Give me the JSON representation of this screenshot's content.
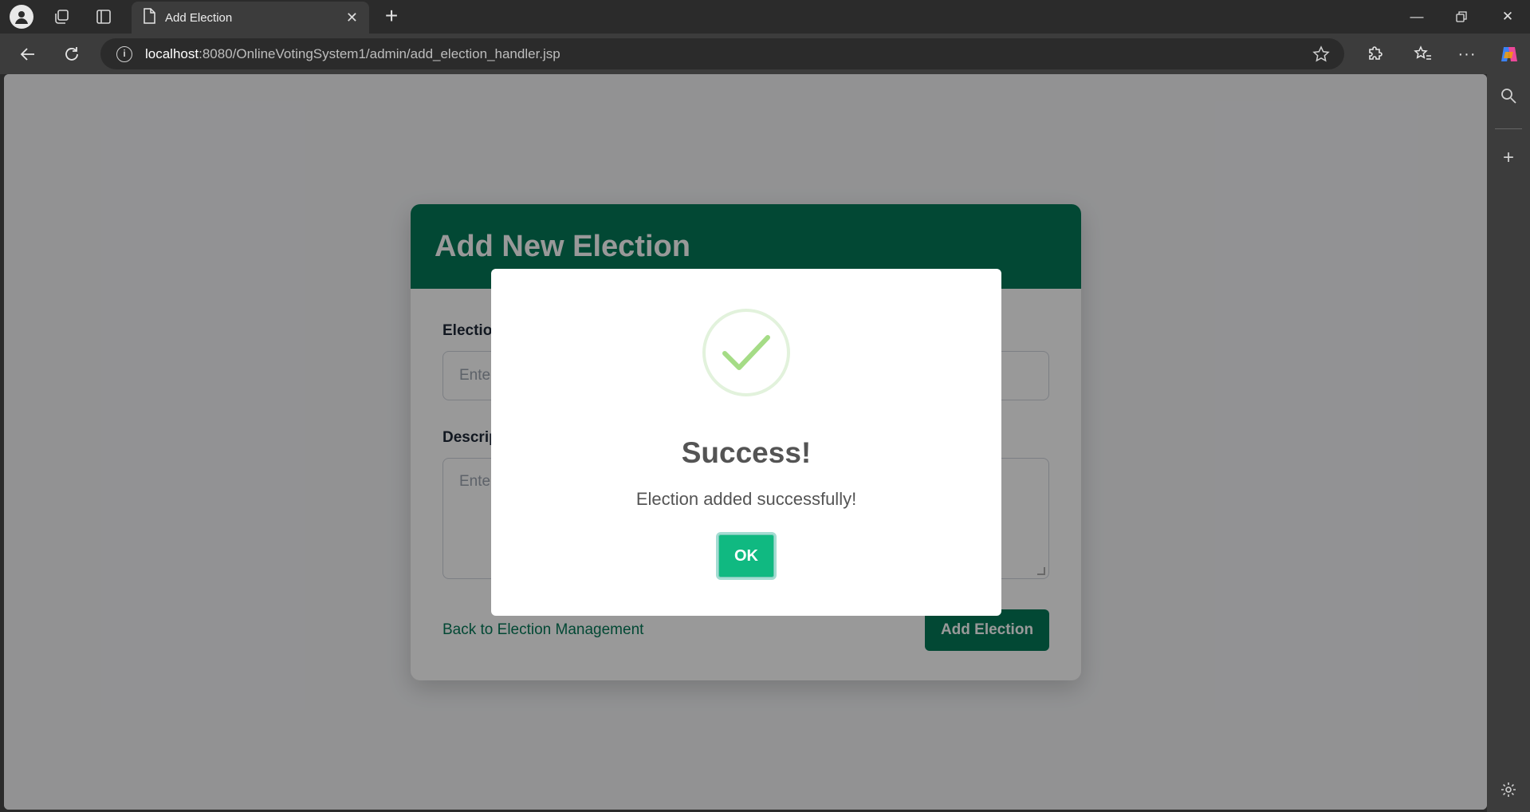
{
  "browser": {
    "tab_title": "Add Election",
    "url_host": "localhost",
    "url_rest": ":8080/OnlineVotingSystem1/admin/add_election_handler.jsp",
    "icons": [
      "profile-icon",
      "workspaces-icon",
      "vertical-tabs-icon",
      "page-icon",
      "close-icon",
      "plus-icon",
      "minimize-icon",
      "restore-icon",
      "close-window-icon",
      "back-arrow-icon",
      "refresh-icon",
      "info-icon",
      "star-icon",
      "extensions-icon",
      "favorites-icon",
      "more-icon",
      "copilot-icon",
      "search-icon",
      "settings-icon"
    ]
  },
  "card": {
    "title": "Add New Election",
    "name_label": "Election",
    "name_placeholder": "Ente",
    "description_label": "Descrip",
    "description_placeholder": "Ente",
    "back_link": "Back to Election Management",
    "submit_label": "Add Election"
  },
  "modal": {
    "title": "Success!",
    "message": "Election added successfully!",
    "ok_label": "OK"
  },
  "colors": {
    "header": "#047857",
    "ok_button": "#10b981",
    "check": "#a5dc86"
  }
}
